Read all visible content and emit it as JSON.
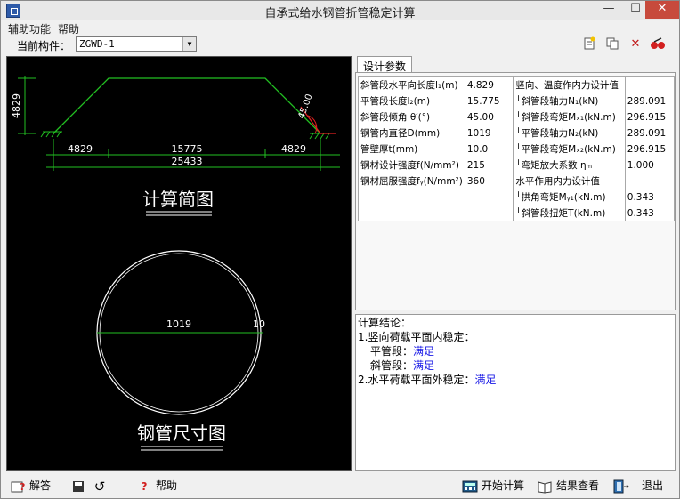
{
  "window": {
    "title": "自承式给水钢管折管稳定计算",
    "min": "—",
    "max": "☐",
    "close": "✕"
  },
  "menu": [
    "辅助功能",
    "帮助"
  ],
  "component": {
    "label": "当前构件：",
    "value": "ZGWD-1"
  },
  "drawing": {
    "height_dim": "4829",
    "angle": "45.00",
    "dims": [
      "4829",
      "15775",
      "4829"
    ],
    "total": "25433",
    "caption1": "计算简图",
    "diameter": "1019",
    "thickness": "10",
    "caption2": "钢管尺寸图"
  },
  "tab": "设计参数",
  "params": {
    "rows": [
      [
        "斜管段水平向长度l₁(m)",
        "4.829",
        "竖向、温度作内力设计值",
        ""
      ],
      [
        "平管段长度l₂(m)",
        "15.775",
        "└斜管段轴力N₁(kN)",
        "289.091"
      ],
      [
        "斜管段倾角 θ′(°)",
        "45.00",
        "└斜管段弯矩Mₓ₁(kN.m)",
        "296.915"
      ],
      [
        "钢管内直径D(mm)",
        "1019",
        "└平管段轴力N₂(kN)",
        "289.091"
      ],
      [
        "管壁厚t(mm)",
        "10.0",
        "└平管段弯矩Mₓ₂(kN.m)",
        "296.915"
      ],
      [
        "钢材设计强度f(N/mm²)",
        "215",
        "└弯矩放大系数 ηₘ",
        "1.000"
      ],
      [
        "钢材屈服强度fᵧ(N/mm²)",
        "360",
        "水平作用内力设计值",
        ""
      ],
      [
        "",
        "",
        "└拱角弯矩Mᵧ₁(kN.m)",
        "0.343"
      ],
      [
        "",
        "",
        "└斜管段扭矩T(kN.m)",
        "0.343"
      ]
    ]
  },
  "result": {
    "heading": "计算结论：",
    "item1": "1.竖向荷载平面内稳定：",
    "flat_label": "平管段：",
    "flat_value": "满足",
    "slope_label": "斜管段：",
    "slope_value": "满足",
    "item2": "2.水平荷载平面外稳定：",
    "item2_value": "满足"
  },
  "bottom": {
    "solve": "解答",
    "help": "帮助",
    "start": "开始计算",
    "view": "结果查看",
    "exit": "退出"
  }
}
